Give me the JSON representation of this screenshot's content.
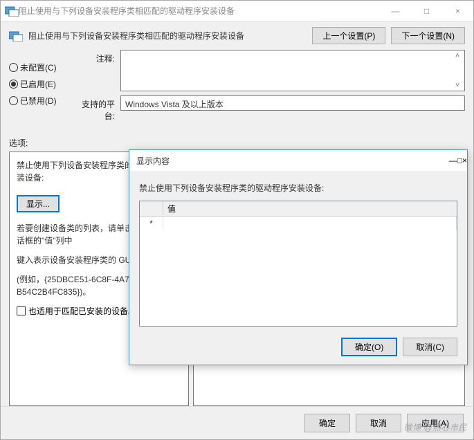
{
  "window": {
    "title": "阻止使用与下列设备安装程序类相匹配的驱动程序安装设备",
    "minimize": "—",
    "maximize": "□",
    "close": "×"
  },
  "header": {
    "text": "阻止使用与下列设备安装程序类相匹配的驱动程序安装设备",
    "prev_setting": "上一个设置(P)",
    "next_setting": "下一个设置(N)"
  },
  "radio": {
    "not_configured": "未配置(C)",
    "enabled": "已启用(E)",
    "disabled": "已禁用(D)"
  },
  "fields": {
    "comment_label": "注释:",
    "platform_label": "支持的平台:",
    "platform_value": "Windows Vista 及以上版本"
  },
  "options_label": "选项:",
  "options": {
    "line1": "禁止使用下列设备安装程序类的驱动程序安装设备:",
    "show_label": "显示...",
    "line2": "若要创建设备类的列表，请单击\"显示内容\"对话框的\"值\"列中",
    "line3": "键入表示设备安装程序类的 GUID",
    "line4": "(例如，{25DBCE51-6C8F-4A72-B54C2B4FC835})。",
    "checkbox_label": "也适用于匹配已安装的设备。"
  },
  "footer": {
    "ok": "确定",
    "cancel": "取消",
    "apply": "应用(A)"
  },
  "modal": {
    "title": "显示内容",
    "minimize": "—",
    "maximize": "□",
    "close": "×",
    "instruction": "禁止使用下列设备安装程序类的驱动程序安装设备:",
    "col_value": "值",
    "row_marker": "*",
    "ok": "确定(O)",
    "cancel": "取消(C)"
  },
  "watermark": "微博 @热心市民"
}
